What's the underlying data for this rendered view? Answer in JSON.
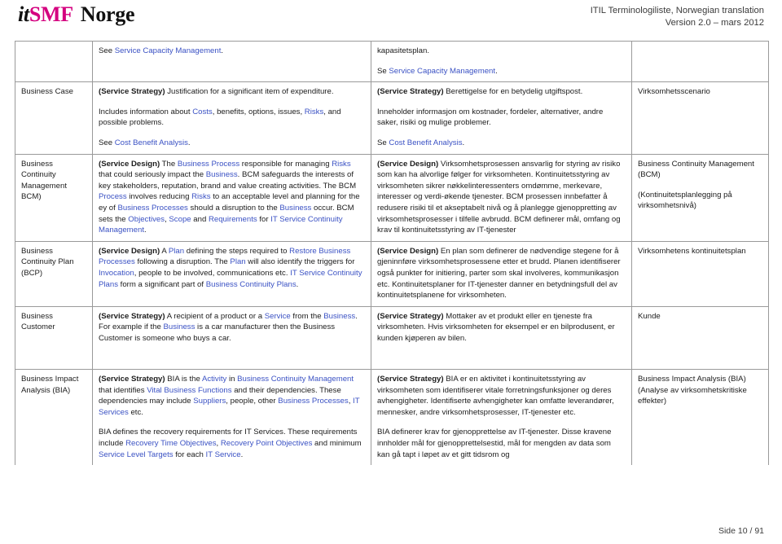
{
  "header": {
    "logo_it": "it",
    "logo_smf": "SMF",
    "logo_norge": "Norge",
    "title_line1": "ITIL Terminologiliste, Norwegian translation",
    "title_line2": "Version 2.0 – mars 2012",
    "accent_color": "#d4007f",
    "link_color": "#3b52c4"
  },
  "footer": {
    "page_label": "Side 10 / 91"
  },
  "table": {
    "rows": [
      {
        "term": "",
        "en": [
          {
            "prefix": "",
            "text_before": "See ",
            "link": "Service Capacity Management",
            "text_after": "."
          }
        ],
        "en_blocks": [
          "See Service Capacity Management."
        ],
        "no_blocks": [
          "kapasitetsplan.",
          "Se Service Capacity Management."
        ],
        "no_term": ""
      },
      {
        "term": "Business Case",
        "en_blocks": [
          "(Service Strategy) Justification for a significant item of expenditure.",
          "Includes information about Costs, benefits, options, issues, Risks, and possible problems.",
          "See Cost Benefit Analysis."
        ],
        "no_blocks": [
          "(Service Strategy) Berettigelse for en betydelig utgiftspost.",
          "Inneholder informasjon om kostnader, fordeler, alternativer, andre saker, risiki og mulige problemer.",
          "Se Cost Benefit Analysis."
        ],
        "no_term": "Virksomhetsscenario"
      },
      {
        "term": "Business Continuity Management BCM)",
        "en_blocks": [
          "(Service Design) The Business Process responsible for managing Risks that could seriously impact the Business. BCM safeguards the interests of key stakeholders, reputation, brand and value creating activities. The BCM Process involves reducing Risks to an acceptable level and planning for the ey of Business Processes should a disruption to the Business occur. BCM sets the Objectives, Scope and Requirements for IT Service Continuity Management."
        ],
        "no_blocks": [
          "(Service Design) Virksomhetsprosessen ansvarlig for styring av risiko som kan ha alvorlige følger for virksomheten. Kontinuitetsstyring av virksomheten sikrer nøkkelinteressenters omdømme, merkevare, interesser og verdi-økende tjenester. BCM prosessen innbefatter å redusere risiki til et akseptabelt nivå og å planlegge gjenoppretting av virksomhetsprosesser i tilfelle avbrudd. BCM definerer mål, omfang og krav til kontinuitetsstyring av IT-tjenester"
        ],
        "no_term_blocks": [
          "Business Continuity Management (BCM)",
          "(Kontinuitetsplanlegging på virksomhetsnivå)"
        ],
        "no_term": "Business Continuity Management (BCM)"
      },
      {
        "term": "Business Continuity Plan (BCP)",
        "en_blocks": [
          "(Service Design) A Plan defining the steps required to Restore Business Processes following a disruption. The Plan will also identify the triggers for Invocation, people to be involved, communications etc. IT Service Continuity Plans form a significant part of Business Continuity Plans."
        ],
        "no_blocks": [
          "(Service Design) En plan som definerer de nødvendige stegene for å gjeninnføre virksomhetsprosessene etter et brudd. Planen identifiserer også punkter for initiering, parter som skal involveres, kommunikasjon etc. Kontinuitetsplaner for IT-tjenester danner en betydningsfull del av kontinuitetsplanene for virksomheten."
        ],
        "no_term": "Virksomhetens kontinuitetsplan"
      },
      {
        "term": "Business Customer",
        "en_blocks": [
          "(Service Strategy) A recipient of a product or a Service from the Business. For example if the Business is a car manufacturer then the Business Customer is someone who buys a car."
        ],
        "no_blocks": [
          "(Service Strategy) Mottaker av et produkt eller en tjeneste fra virksomheten. Hvis virksomheten for eksempel er en bilprodusent, er kunden kjøperen av bilen."
        ],
        "no_term": "Kunde"
      },
      {
        "term": "Business Impact Analysis (BIA)",
        "en_blocks": [
          "(Service Strategy) BIA is the Activity in Business Continuity Management that identifies Vital Business Functions and their dependencies. These dependencies may include Suppliers, people, other Business Processes, IT Services etc.",
          "BIA defines the recovery requirements for IT Services. These requirements include Recovery Time Objectives, Recovery Point Objectives and minimum Service Level Targets for each IT Service."
        ],
        "no_blocks": [
          "(Service Strategy) BIA er en aktivitet i kontinuitetsstyring av virksomheten som identifiserer vitale forretningsfunksjoner og deres avhengigheter. Identifiserte avhengigheter kan omfatte leverandører, mennesker, andre virksomhetsprosesser, IT-tjenester etc.",
          "BIA definerer krav for gjenopprettelse av IT-tjenester. Disse kravene innholder mål for gjenopprettelsestid, mål for mengden av data som kan gå tapt i løpet av et gitt tidsrom og"
        ],
        "no_term_blocks": [
          "Business Impact Analysis (BIA)",
          "(Analyse av virksomhetskritiske effekter)"
        ],
        "no_term": "Business Impact Analysis (BIA)"
      }
    ]
  }
}
